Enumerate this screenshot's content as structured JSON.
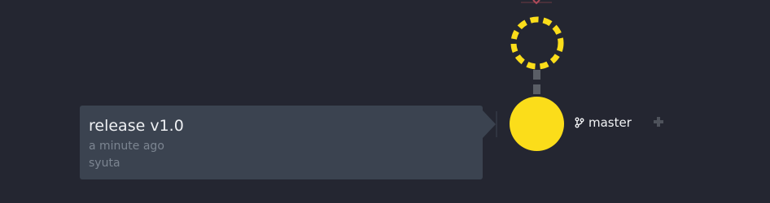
{
  "commit": {
    "title": "release v1.0",
    "time": "a minute ago",
    "author": "syuta"
  },
  "branch": {
    "name": "master",
    "icon": "git-branch-icon"
  },
  "add_button_icon": "plus-icon",
  "colors": {
    "background": "#242631",
    "card": "#3b4350",
    "commit_node": "#fbdd1a",
    "connector": "#5a5e66",
    "muted_text": "#7c8591",
    "accent_arrow": "#b04a5a"
  }
}
